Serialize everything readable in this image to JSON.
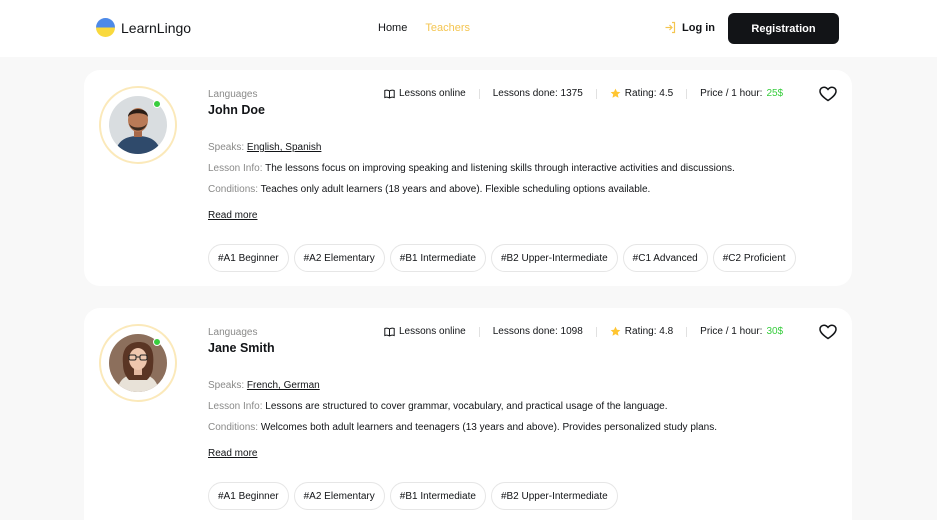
{
  "header": {
    "logo_text": "LearnLingo",
    "nav": {
      "home": "Home",
      "teachers": "Teachers"
    },
    "login_label": "Log in",
    "register_label": "Registration"
  },
  "colors": {
    "accent": "#f4c550",
    "online": "#38cd3e",
    "dark": "#121417",
    "muted": "#8a8a89"
  },
  "teachers": [
    {
      "languages_label": "Languages",
      "name": "John Doe",
      "lessons_online": "Lessons online",
      "lessons_done": "Lessons done: 1375",
      "rating": "Rating: 4.5",
      "price_label": "Price / 1 hour:",
      "price_value": "25$",
      "speaks_label": "Speaks:",
      "speaks_value": "English, Spanish",
      "lesson_info_label": "Lesson Info:",
      "lesson_info": "The lessons focus on improving speaking and listening skills through interactive activities and discussions.",
      "conditions_label": "Conditions:",
      "conditions": "Teaches only adult learners (18 years and above). Flexible scheduling options available.",
      "read_more": "Read more",
      "levels": [
        "#A1 Beginner",
        "#A2 Elementary",
        "#B1 Intermediate",
        "#B2 Upper-Intermediate",
        "#C1 Advanced",
        "#C2 Proficient"
      ]
    },
    {
      "languages_label": "Languages",
      "name": "Jane Smith",
      "lessons_online": "Lessons online",
      "lessons_done": "Lessons done: 1098",
      "rating": "Rating: 4.8",
      "price_label": "Price / 1 hour:",
      "price_value": "30$",
      "speaks_label": "Speaks:",
      "speaks_value": "French, German",
      "lesson_info_label": "Lesson Info:",
      "lesson_info": "Lessons are structured to cover grammar, vocabulary, and practical usage of the language.",
      "conditions_label": "Conditions:",
      "conditions": "Welcomes both adult learners and teenagers (13 years and above). Provides personalized study plans.",
      "read_more": "Read more",
      "levels": [
        "#A1 Beginner",
        "#A2 Elementary",
        "#B1 Intermediate",
        "#B2 Upper-Intermediate"
      ]
    }
  ]
}
